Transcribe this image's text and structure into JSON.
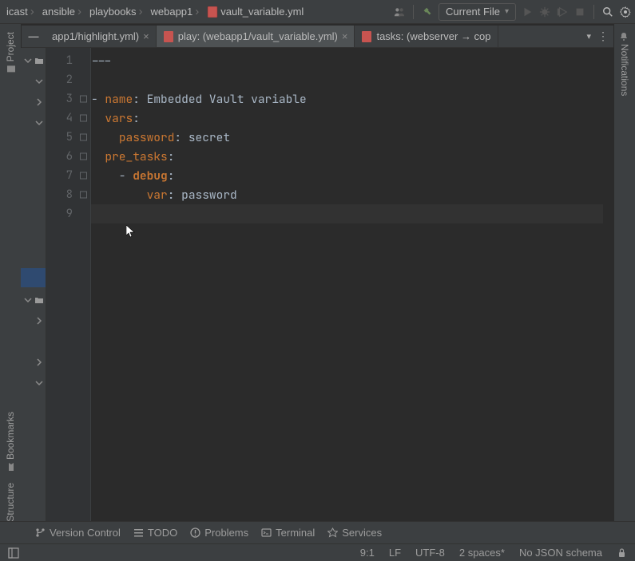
{
  "breadcrumb": {
    "items": [
      "icast",
      "ansible",
      "playbooks",
      "webapp1",
      "vault_variable.yml"
    ]
  },
  "run_config": {
    "label": "Current File"
  },
  "tabs": {
    "t1": {
      "label": "app1/highlight.yml)"
    },
    "t2": {
      "label": "play: (webapp1/vault_variable.yml)"
    },
    "t3": {
      "label": "tasks: (webserver → cop"
    }
  },
  "side": {
    "left": {
      "project": "Project",
      "bookmarks": "Bookmarks",
      "structure": "Structure"
    },
    "right": {
      "notifications": "Notifications"
    }
  },
  "code": {
    "l1": "---",
    "l3_pre": "- ",
    "l3_key": "name",
    "l3_rest": ": Embedded Vault variable",
    "l4_key": "vars",
    "l4_rest": ":",
    "l5_pre": "    ",
    "l5_key": "password",
    "l5_rest": ": secret",
    "l6_key": "pre_tasks",
    "l6_rest": ":",
    "l7_pre": "    - ",
    "l7_key": "debug",
    "l7_rest": ":",
    "l8_pre": "        ",
    "l8_key": "var",
    "l8_rest": ": password"
  },
  "gutter": {
    "n1": "1",
    "n2": "2",
    "n3": "3",
    "n4": "4",
    "n5": "5",
    "n6": "6",
    "n7": "7",
    "n8": "8",
    "n9": "9"
  },
  "bottom": {
    "vcs": "Version Control",
    "todo": "TODO",
    "problems": "Problems",
    "terminal": "Terminal",
    "services": "Services"
  },
  "status": {
    "pos": "9:1",
    "eol": "LF",
    "enc": "UTF-8",
    "indent": "2 spaces*",
    "schema": "No JSON schema"
  }
}
